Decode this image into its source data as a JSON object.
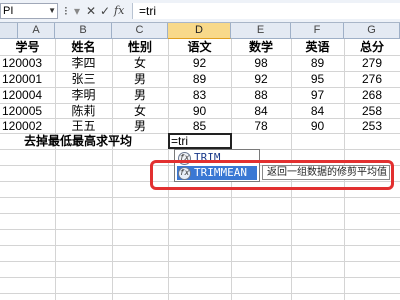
{
  "formula_bar": {
    "name_box": "PI",
    "cancel_icon": "✕",
    "enter_icon": "✓",
    "fx_label": "fx",
    "formula": "=tri"
  },
  "columns": [
    "A",
    "B",
    "C",
    "D",
    "E",
    "F",
    "G"
  ],
  "selected_column": "D",
  "table": {
    "headers": [
      "学号",
      "姓名",
      "性别",
      "语文",
      "数学",
      "英语",
      "总分"
    ],
    "rows": [
      [
        "120003",
        "李四",
        "女",
        "92",
        "98",
        "89",
        "279"
      ],
      [
        "120001",
        "张三",
        "男",
        "89",
        "92",
        "95",
        "276"
      ],
      [
        "120004",
        "李明",
        "男",
        "83",
        "88",
        "97",
        "268"
      ],
      [
        "120005",
        "陈莉",
        "女",
        "90",
        "84",
        "84",
        "258"
      ],
      [
        "120002",
        "王五",
        "男",
        "85",
        "78",
        "90",
        "253"
      ]
    ]
  },
  "label_row": {
    "label": "去掉最低最高求平均",
    "active_cell_value": "=tri"
  },
  "autocomplete": {
    "icon": "fx-function-icon",
    "items": [
      "TRIM",
      "TRIMMEAN"
    ],
    "selected_index": 1,
    "tooltip": "返回一组数据的修剪平均值"
  },
  "colors": {
    "selected_column_header": "#f8d98a",
    "selected_item": "#3a78d4",
    "highlight_box": "#e23030"
  }
}
